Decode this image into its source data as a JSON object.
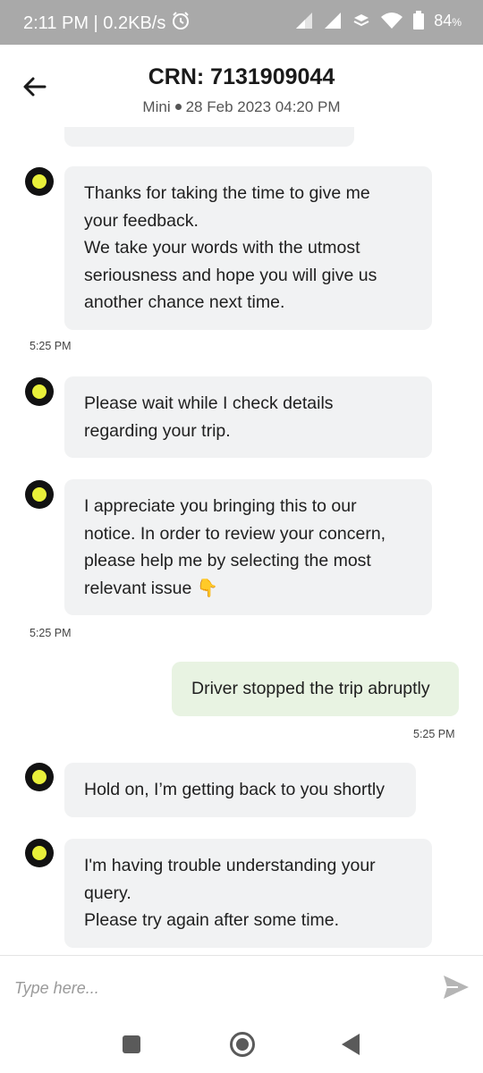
{
  "status_bar": {
    "time_speed": "2:11 PM | 0.2KB/s",
    "battery_percent": "84",
    "battery_suffix": "%",
    "icons": [
      "alarm-icon",
      "signal-icon",
      "signal-icon",
      "data-saver-icon",
      "wifi-icon",
      "battery-icon"
    ]
  },
  "header": {
    "title": "CRN: 7131909044",
    "category": "Mini",
    "datetime": "28 Feb 2023 04:20 PM",
    "back_icon": "back-arrow-icon"
  },
  "messages": [
    {
      "direction": "incoming",
      "lines": [
        "Thanks for taking the time to give me",
        "your feedback.",
        "We take your words with the utmost",
        "seriousness and hope you will give us",
        "another chance next time."
      ],
      "time": "5:25 PM"
    },
    {
      "direction": "incoming",
      "lines": [
        "Please wait while I check details",
        "regarding your trip."
      ]
    },
    {
      "direction": "incoming",
      "lines": [
        "I appreciate you bringing this to our",
        "notice. In order to review your concern,",
        "please help me by selecting the most",
        "relevant issue 👇"
      ],
      "time": "5:25 PM"
    },
    {
      "direction": "outgoing",
      "lines": [
        "Driver stopped the trip abruptly"
      ],
      "time": "5:25 PM"
    },
    {
      "direction": "incoming",
      "lines": [
        "Hold on, I’m getting back to you shortly"
      ]
    },
    {
      "direction": "incoming",
      "lines": [
        "I'm having trouble understanding your",
        "query.",
        "Please try again after some time."
      ]
    }
  ],
  "composer": {
    "placeholder": "Type here...",
    "send_icon": "send-icon"
  },
  "colors": {
    "status_bar": "#a9a9a9",
    "incoming_bubble": "#f1f2f3",
    "outgoing_bubble": "#e8f3e2",
    "avatar_ring": "#121212",
    "avatar_dot": "#e9f03a"
  }
}
